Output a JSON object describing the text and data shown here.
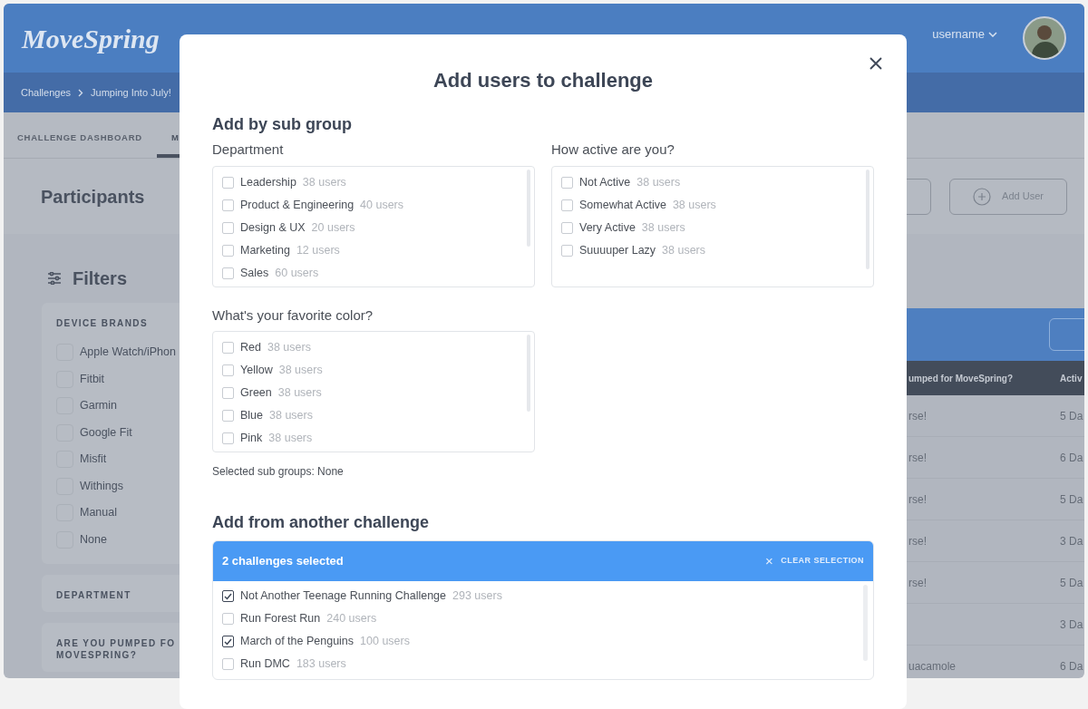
{
  "app": {
    "logo": "MoveSpring",
    "user_menu": "username",
    "breadcrumb": [
      "Challenges",
      "Jumping Into July!"
    ],
    "tabs": [
      {
        "label": "CHALLENGE DASHBOARD",
        "selected": false
      },
      {
        "label": "M",
        "selected": true
      }
    ],
    "page_title": "Participants",
    "add_user_button": "Add User",
    "filters": {
      "title": "Filters",
      "sections": [
        {
          "title_lines": [
            "DEVICE BRANDS"
          ],
          "options": [
            {
              "label": "Apple Watch/iPhon",
              "checked": false
            },
            {
              "label": "Fitbit",
              "checked": false
            },
            {
              "label": "Garmin",
              "checked": false
            },
            {
              "label": "Google Fit",
              "checked": false
            },
            {
              "label": "Misfit",
              "checked": false
            },
            {
              "label": "Withings",
              "checked": false
            },
            {
              "label": "Manual",
              "checked": false
            },
            {
              "label": "None",
              "checked": false
            }
          ]
        },
        {
          "title_lines": [
            "DEPARTMENT"
          ]
        },
        {
          "title_lines": [
            "ARE YOU PUMPED FO",
            "MOVESPRING?"
          ]
        }
      ]
    },
    "table": {
      "columns": [
        "umped for MoveSpring?",
        "Activ"
      ],
      "rows": [
        [
          "rse!",
          "5 Da"
        ],
        [
          "rse!",
          "6 Da"
        ],
        [
          "rse!",
          "5 Da"
        ],
        [
          "rse!",
          "3 Da"
        ],
        [
          "rse!",
          "5 Da"
        ],
        [
          "",
          "3 Da"
        ],
        [
          "uacamole",
          "6 Da"
        ]
      ]
    }
  },
  "modal": {
    "title": "Add users to challenge",
    "sub_group_heading": "Add by sub group",
    "sub_groups": [
      {
        "label": "Department",
        "options": [
          {
            "name": "Leadership",
            "count": "38 users",
            "checked": false
          },
          {
            "name": "Product & Engineering",
            "count": "40 users",
            "checked": false
          },
          {
            "name": "Design & UX",
            "count": "20 users",
            "checked": false
          },
          {
            "name": "Marketing",
            "count": "12 users",
            "checked": false
          },
          {
            "name": "Sales",
            "count": "60 users",
            "checked": false
          }
        ]
      },
      {
        "label": "How active are you?",
        "options": [
          {
            "name": "Not Active",
            "count": "38 users",
            "checked": false
          },
          {
            "name": "Somewhat Active",
            "count": "38 users",
            "checked": false
          },
          {
            "name": "Very Active",
            "count": "38 users",
            "checked": false
          },
          {
            "name": "Suuuuper Lazy",
            "count": "38 users",
            "checked": false
          }
        ]
      },
      {
        "label": "What's your favorite color?",
        "options": [
          {
            "name": "Red",
            "count": "38 users",
            "checked": false
          },
          {
            "name": "Yellow",
            "count": "38 users",
            "checked": false
          },
          {
            "name": "Green",
            "count": "38 users",
            "checked": false
          },
          {
            "name": "Blue",
            "count": "38 users",
            "checked": false
          },
          {
            "name": "Pink",
            "count": "38 users",
            "checked": false
          }
        ]
      }
    ],
    "selected_summary": "Selected sub groups: None",
    "challenge_heading": "Add from another challenge",
    "selection_bar": {
      "text": "2 challenges selected",
      "clear_icon": "×",
      "clear_label": "CLEAR SELECTION"
    },
    "challenges": [
      {
        "name": "Not Another Teenage Running Challenge",
        "count": "293 users",
        "checked": true
      },
      {
        "name": "Run Forest Run",
        "count": "240 users",
        "checked": false
      },
      {
        "name": "March of the Penguins",
        "count": "100 users",
        "checked": true
      },
      {
        "name": "Run DMC",
        "count": "183 users",
        "checked": false
      }
    ]
  }
}
